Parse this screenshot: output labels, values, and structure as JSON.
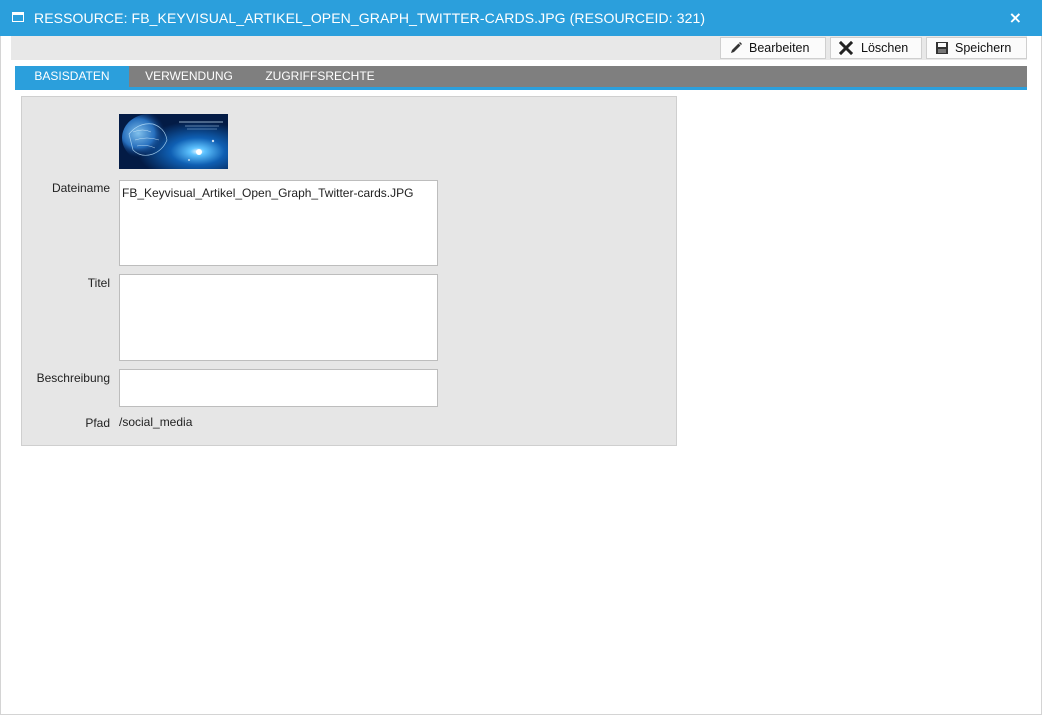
{
  "window": {
    "title": "RESSOURCE: FB_KEYVISUAL_ARTIKEL_OPEN_GRAPH_TWITTER-CARDS.JPG (RESOURCEID: 321)",
    "close_label": "×"
  },
  "toolbar": {
    "edit_label": "Bearbeiten",
    "delete_label": "Löschen",
    "save_label": "Speichern"
  },
  "tabs": [
    {
      "label": "BASISDATEN",
      "active": true
    },
    {
      "label": "VERWENDUNG",
      "active": false
    },
    {
      "label": "ZUGRIFFSRECHTE",
      "active": false
    }
  ],
  "form": {
    "filename_label": "Dateiname",
    "filename_value": "FB_Keyvisual_Artikel_Open_Graph_Twitter-cards.JPG",
    "title_label": "Titel",
    "title_value": "",
    "description_label": "Beschreibung",
    "description_value": "",
    "path_label": "Pfad",
    "path_value": "/social_media"
  },
  "colors": {
    "accent": "#2b9fdc",
    "tab_bar": "#7f7f7f",
    "panel_bg": "#e6e6e6"
  },
  "icons": [
    "window-icon",
    "close-icon",
    "pencil-icon",
    "x-icon",
    "floppy-disk-icon"
  ]
}
